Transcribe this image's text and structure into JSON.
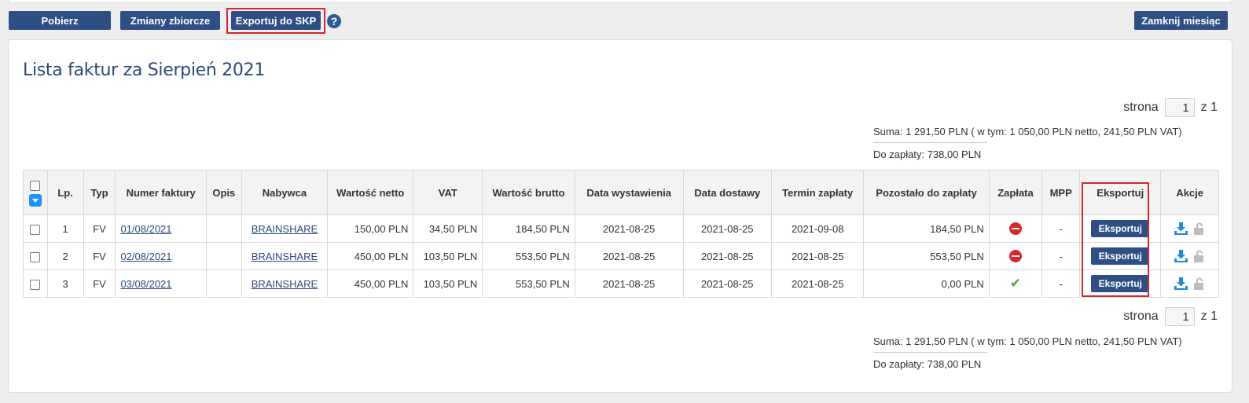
{
  "toolbar": {
    "pobierz": "Pobierz",
    "zmiany": "Zmiany zbiorcze",
    "export_skp": "Exportuj do SKP",
    "help": "?",
    "close_month": "Zamknij miesiąc"
  },
  "title": "Lista faktur za Sierpień 2021",
  "pager": {
    "label": "strona",
    "value": "1",
    "of": "z 1"
  },
  "summary": {
    "sum": "Suma:  1 291,50 PLN  ( w tym: 1 050,00 PLN netto, 241,50 PLN VAT)",
    "due": "Do zapłaty:  738,00 PLN"
  },
  "table": {
    "headers": {
      "lp": "Lp.",
      "typ": "Typ",
      "numer": "Numer faktury",
      "opis": "Opis",
      "nabywca": "Nabywca",
      "netto": "Wartość netto",
      "vat": "VAT",
      "brutto": "Wartość brutto",
      "data_wyst": "Data wystawienia",
      "data_dost": "Data dostawy",
      "termin": "Termin zapłaty",
      "pozostalo": "Pozostało do zapłaty",
      "zaplata": "Zapłata",
      "mpp": "MPP",
      "eksportuj": "Eksportuj",
      "akcje": "Akcje"
    },
    "rows": [
      {
        "lp": "1",
        "typ": "FV",
        "numer": "01/08/2021",
        "opis": "",
        "nabywca": "BRAINSHARE",
        "netto": "150,00 PLN",
        "vat": "34,50 PLN",
        "brutto": "184,50 PLN",
        "data_wyst": "2021-08-25",
        "data_dost": "2021-08-25",
        "termin": "2021-09-08",
        "pozostalo": "184,50 PLN",
        "paid": false,
        "mpp": "-",
        "export_label": "Eksportuj"
      },
      {
        "lp": "2",
        "typ": "FV",
        "numer": "02/08/2021",
        "opis": "",
        "nabywca": "BRAINSHARE",
        "netto": "450,00 PLN",
        "vat": "103,50 PLN",
        "brutto": "553,50 PLN",
        "data_wyst": "2021-08-25",
        "data_dost": "2021-08-25",
        "termin": "2021-08-25",
        "pozostalo": "553,50 PLN",
        "paid": false,
        "mpp": "-",
        "export_label": "Eksportuj"
      },
      {
        "lp": "3",
        "typ": "FV",
        "numer": "03/08/2021",
        "opis": "",
        "nabywca": "BRAINSHARE",
        "netto": "450,00 PLN",
        "vat": "103,50 PLN",
        "brutto": "553,50 PLN",
        "data_wyst": "2021-08-25",
        "data_dost": "2021-08-25",
        "termin": "2021-08-25",
        "pozostalo": "0,00 PLN",
        "paid": true,
        "mpp": "-",
        "export_label": "Eksportuj"
      }
    ]
  },
  "colors": {
    "primary": "#2d4f84",
    "highlight": "#d6252b",
    "unpaid": "#d9262c",
    "paid": "#48a838",
    "download": "#1e88e5"
  }
}
